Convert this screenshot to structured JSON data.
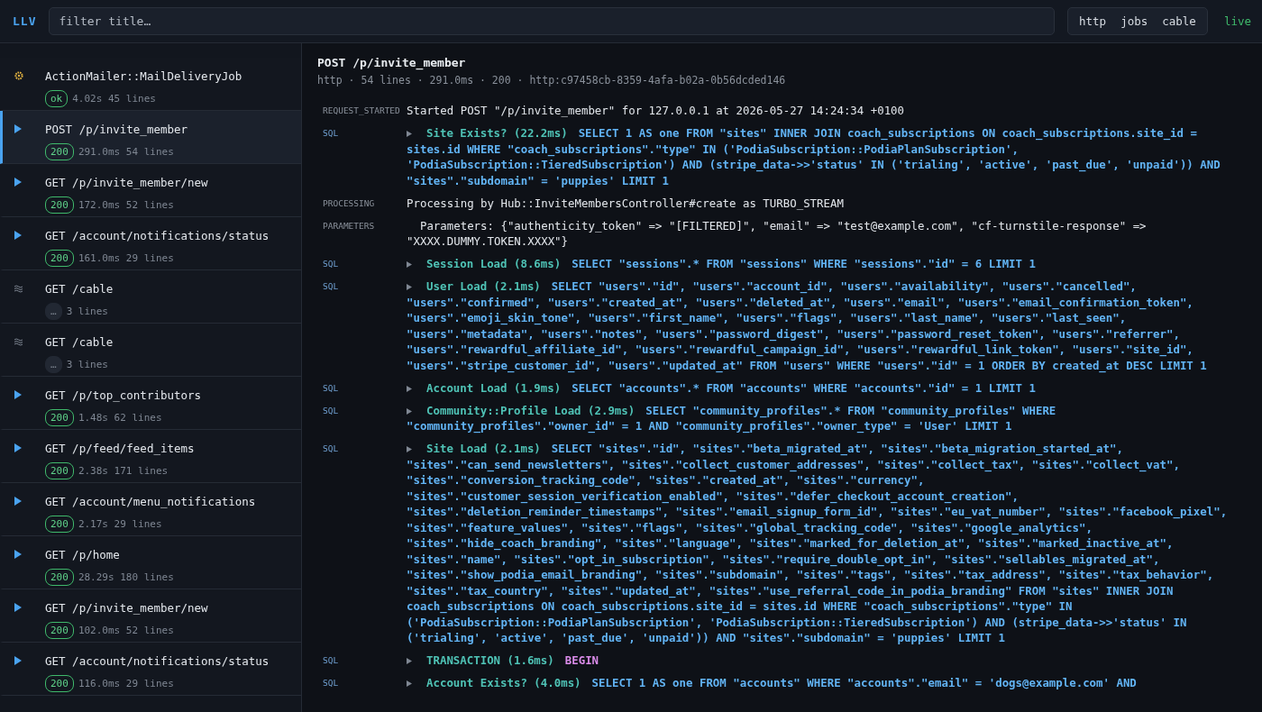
{
  "header": {
    "logo": "LLV",
    "filter": {
      "placeholder": "filter title…"
    },
    "toggles": [
      {
        "label": "http"
      },
      {
        "label": "jobs"
      },
      {
        "label": "cable"
      }
    ],
    "live": "live"
  },
  "sidebar": {
    "items": [
      {
        "kind": "job",
        "title": "ActionMailer::MailDeliveryJob",
        "badge": {
          "kind": "success",
          "label": "ok"
        },
        "meta": "4.02s 45 lines",
        "selected": false
      },
      {
        "kind": "http",
        "title": "POST /p/invite_member",
        "badge": {
          "kind": "success",
          "label": "200"
        },
        "meta": "291.0ms 54 lines",
        "selected": true
      },
      {
        "kind": "http",
        "title": "GET /p/invite_member/new",
        "badge": {
          "kind": "success",
          "label": "200"
        },
        "meta": "172.0ms 52 lines",
        "selected": false
      },
      {
        "kind": "http",
        "title": "GET /account/notifications/status",
        "badge": {
          "kind": "success",
          "label": "200"
        },
        "meta": "161.0ms 29 lines",
        "selected": false
      },
      {
        "kind": "cable",
        "title": "GET /cable",
        "badge": {
          "kind": "pending",
          "label": "…"
        },
        "meta": "3 lines",
        "selected": false
      },
      {
        "kind": "cable",
        "title": "GET /cable",
        "badge": {
          "kind": "pending",
          "label": "…"
        },
        "meta": "3 lines",
        "selected": false
      },
      {
        "kind": "http",
        "title": "GET /p/top_contributors",
        "badge": {
          "kind": "success",
          "label": "200"
        },
        "meta": "1.48s 62 lines",
        "selected": false
      },
      {
        "kind": "http",
        "title": "GET /p/feed/feed_items",
        "badge": {
          "kind": "success",
          "label": "200"
        },
        "meta": "2.38s 171 lines",
        "selected": false
      },
      {
        "kind": "http",
        "title": "GET /account/menu_notifications",
        "badge": {
          "kind": "success",
          "label": "200"
        },
        "meta": "2.17s 29 lines",
        "selected": false
      },
      {
        "kind": "http",
        "title": "GET /p/home",
        "badge": {
          "kind": "success",
          "label": "200"
        },
        "meta": "28.29s 180 lines",
        "selected": false
      },
      {
        "kind": "http",
        "title": "GET /p/invite_member/new",
        "badge": {
          "kind": "success",
          "label": "200"
        },
        "meta": "102.0ms 52 lines",
        "selected": false
      },
      {
        "kind": "http",
        "title": "GET /account/notifications/status",
        "badge": {
          "kind": "success",
          "label": "200"
        },
        "meta": "116.0ms 29 lines",
        "selected": false
      }
    ]
  },
  "detail": {
    "title": "POST /p/invite_member",
    "meta": "http · 54 lines · 291.0ms · 200 · http:c97458cb-8359-4afa-b02a-0b56dcded146",
    "entries": [
      {
        "kind": "text",
        "tag": "REQUEST_STARTED",
        "text": "Started POST \"/p/invite_member\" for 127.0.0.1 at 2026-05-27 14:24:34 +0100"
      },
      {
        "kind": "query",
        "tag": "SQL",
        "name": "Site Exists? (22.2ms)",
        "statement": "SELECT 1 AS one FROM \"sites\" INNER JOIN coach_subscriptions ON coach_subscriptions.site_id = sites.id WHERE \"coach_subscriptions\".\"type\" IN ('PodiaSubscription::PodiaPlanSubscription', 'PodiaSubscription::TieredSubscription') AND (stripe_data->>'status' IN ('trialing', 'active', 'past_due', 'unpaid')) AND \"sites\".\"subdomain\" = 'puppies' LIMIT 1"
      },
      {
        "kind": "text",
        "tag": "PROCESSING",
        "text": "Processing by Hub::InviteMembersController#create as TURBO_STREAM"
      },
      {
        "kind": "text",
        "tag": "PARAMETERS",
        "text": "  Parameters: {\"authenticity_token\" => \"[FILTERED]\", \"email\" => \"test@example.com\", \"cf-turnstile-response\" => \"XXXX.DUMMY.TOKEN.XXXX\"}"
      },
      {
        "kind": "query",
        "tag": "SQL",
        "name": "Session Load (8.6ms)",
        "statement": "SELECT \"sessions\".* FROM \"sessions\" WHERE \"sessions\".\"id\" = 6 LIMIT 1"
      },
      {
        "kind": "query",
        "tag": "SQL",
        "name": "User Load (2.1ms)",
        "statement": "SELECT \"users\".\"id\", \"users\".\"account_id\", \"users\".\"availability\", \"users\".\"cancelled\", \"users\".\"confirmed\", \"users\".\"created_at\", \"users\".\"deleted_at\", \"users\".\"email\", \"users\".\"email_confirmation_token\", \"users\".\"emoji_skin_tone\", \"users\".\"first_name\", \"users\".\"flags\", \"users\".\"last_name\", \"users\".\"last_seen\", \"users\".\"metadata\", \"users\".\"notes\", \"users\".\"password_digest\", \"users\".\"password_reset_token\", \"users\".\"referrer\", \"users\".\"rewardful_affiliate_id\", \"users\".\"rewardful_campaign_id\", \"users\".\"rewardful_link_token\", \"users\".\"site_id\", \"users\".\"stripe_customer_id\", \"users\".\"updated_at\" FROM \"users\" WHERE \"users\".\"id\" = 1 ORDER BY created_at DESC LIMIT 1"
      },
      {
        "kind": "query",
        "tag": "SQL",
        "name": "Account Load (1.9ms)",
        "statement": "SELECT \"accounts\".* FROM \"accounts\" WHERE \"accounts\".\"id\" = 1 LIMIT 1"
      },
      {
        "kind": "query",
        "tag": "SQL",
        "name": "Community::Profile Load (2.9ms)",
        "statement": "SELECT \"community_profiles\".* FROM \"community_profiles\" WHERE \"community_profiles\".\"owner_id\" = 1 AND \"community_profiles\".\"owner_type\" = 'User' LIMIT 1"
      },
      {
        "kind": "query",
        "tag": "SQL",
        "name": "Site Load (2.1ms)",
        "statement": "SELECT \"sites\".\"id\", \"sites\".\"beta_migrated_at\", \"sites\".\"beta_migration_started_at\", \"sites\".\"can_send_newsletters\", \"sites\".\"collect_customer_addresses\", \"sites\".\"collect_tax\", \"sites\".\"collect_vat\", \"sites\".\"conversion_tracking_code\", \"sites\".\"created_at\", \"sites\".\"currency\", \"sites\".\"customer_session_verification_enabled\", \"sites\".\"defer_checkout_account_creation\", \"sites\".\"deletion_reminder_timestamps\", \"sites\".\"email_signup_form_id\", \"sites\".\"eu_vat_number\", \"sites\".\"facebook_pixel\", \"sites\".\"feature_values\", \"sites\".\"flags\", \"sites\".\"global_tracking_code\", \"sites\".\"google_analytics\", \"sites\".\"hide_coach_branding\", \"sites\".\"language\", \"sites\".\"marked_for_deletion_at\", \"sites\".\"marked_inactive_at\", \"sites\".\"name\", \"sites\".\"opt_in_subscription\", \"sites\".\"require_double_opt_in\", \"sites\".\"sellables_migrated_at\", \"sites\".\"show_podia_email_branding\", \"sites\".\"subdomain\", \"sites\".\"tags\", \"sites\".\"tax_address\", \"sites\".\"tax_behavior\", \"sites\".\"tax_country\", \"sites\".\"updated_at\", \"sites\".\"use_referral_code_in_podia_branding\" FROM \"sites\" INNER JOIN coach_subscriptions ON coach_subscriptions.site_id = sites.id WHERE \"coach_subscriptions\".\"type\" IN ('PodiaSubscription::PodiaPlanSubscription', 'PodiaSubscription::TieredSubscription') AND (stripe_data->>'status' IN ('trialing', 'active', 'past_due', 'unpaid')) AND \"sites\".\"subdomain\" = 'puppies' LIMIT 1"
      },
      {
        "kind": "transaction",
        "tag": "SQL",
        "name": "TRANSACTION (1.6ms)",
        "statement": "BEGIN"
      },
      {
        "kind": "query",
        "tag": "SQL",
        "name": "Account Exists? (4.0ms)",
        "statement": "SELECT 1 AS one FROM \"accounts\" WHERE \"accounts\".\"email\" = 'dogs@example.com' AND"
      }
    ]
  }
}
